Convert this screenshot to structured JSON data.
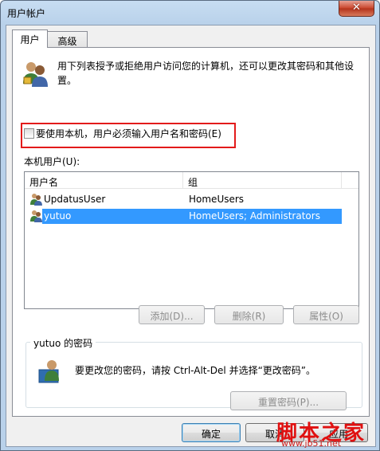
{
  "window": {
    "title": "用户帐户",
    "close_glyph": "✕"
  },
  "tabs": [
    {
      "label": "用户",
      "active": true
    },
    {
      "label": "高级",
      "active": false
    }
  ],
  "description": "用下列表授予或拒绝用户访问您的计算机，还可以更改其密码和其他设置。",
  "checkbox": {
    "label": "要使用本机，用户必须输入用户名和密码(E)",
    "checked": false
  },
  "user_list": {
    "label": "本机用户(U):",
    "columns": [
      "用户名",
      "组"
    ],
    "rows": [
      {
        "name": "UpdatusUser",
        "group": "HomeUsers",
        "selected": false
      },
      {
        "name": "yutuo",
        "group": "HomeUsers; Administrators",
        "selected": true
      }
    ]
  },
  "list_buttons": {
    "add": "添加(D)...",
    "remove": "删除(R)",
    "properties": "属性(O)"
  },
  "password_group": {
    "legend": "yutuo 的密码",
    "text": "要更改您的密码，请按 Ctrl-Alt-Del 并选择“更改密码”。",
    "reset_button": "重置密码(P)..."
  },
  "footer": {
    "ok": "确定",
    "cancel": "取消",
    "apply": "应用"
  },
  "watermark": {
    "text": "脚本之家",
    "url": "www.jb51.net"
  },
  "colors": {
    "highlight_box": "#e31b1b",
    "selection": "#3399ff",
    "watermark": "#e01010"
  }
}
